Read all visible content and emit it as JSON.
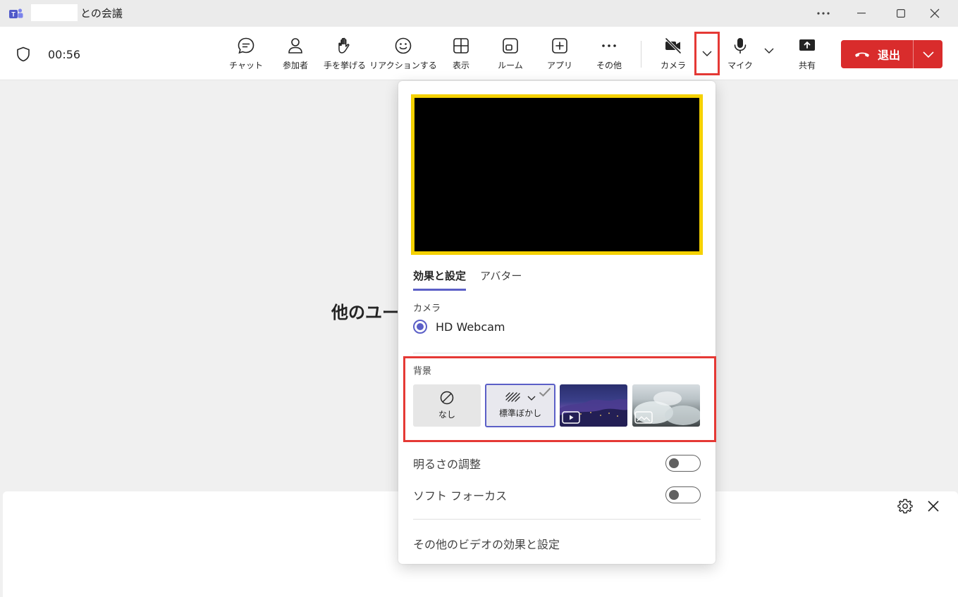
{
  "window": {
    "title": "との会議",
    "more_icon": "ellipsis-icon",
    "minimize_icon": "minimize-icon",
    "maximize_icon": "maximize-icon",
    "close_icon": "close-icon"
  },
  "toolbar": {
    "timer": "00:56",
    "items": [
      {
        "label": "チャット",
        "icon": "chat-icon"
      },
      {
        "label": "参加者",
        "icon": "people-icon"
      },
      {
        "label": "手を挙げる",
        "icon": "raise-hand-icon"
      },
      {
        "label": "リアクションする",
        "icon": "emoji-icon"
      },
      {
        "label": "表示",
        "icon": "view-grid-icon"
      },
      {
        "label": "ルーム",
        "icon": "rooms-icon"
      },
      {
        "label": "アプリ",
        "icon": "add-apps-icon"
      },
      {
        "label": "その他",
        "icon": "more-icon"
      },
      {
        "label": "カメラ",
        "icon": "camera-off-icon"
      },
      {
        "label": "マイク",
        "icon": "microphone-icon"
      },
      {
        "label": "共有",
        "icon": "share-icon"
      }
    ],
    "leave_label": "退出",
    "leave_color": "#d92c2c"
  },
  "stage": {
    "waiting_text": "他のユー"
  },
  "popup": {
    "tabs": [
      "効果と設定",
      "アバター"
    ],
    "camera_section_label": "カメラ",
    "camera_device": "HD Webcam",
    "background_label": "背景",
    "backgrounds": {
      "none": "なし",
      "blur": "標準ぼかし"
    },
    "brightness_label": "明るさの調整",
    "soft_focus_label": "ソフト フォーカス",
    "brightness_on": false,
    "soft_focus_on": false,
    "more_settings": "その他のビデオの効果と設定",
    "accent_color": "#5b5fc7",
    "highlight_color": "#e53935",
    "preview_border_color": "#f5d100"
  }
}
